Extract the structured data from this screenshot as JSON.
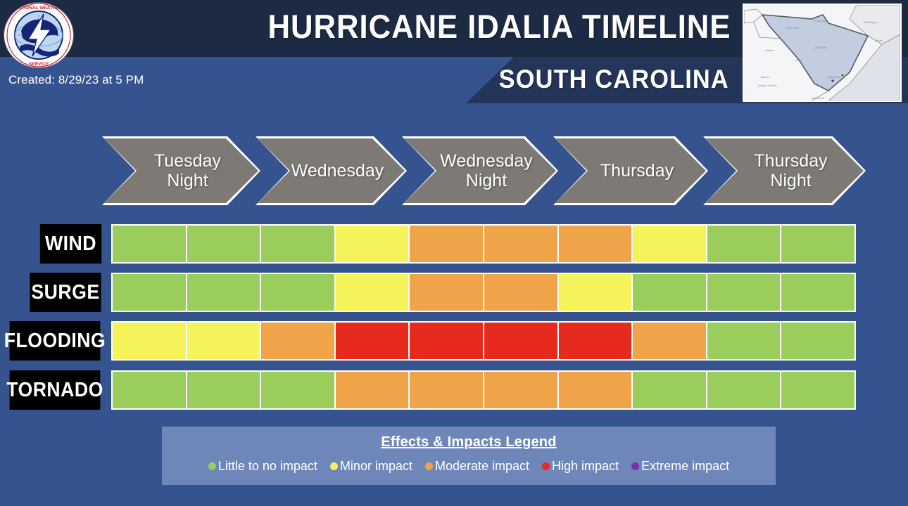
{
  "header": {
    "title": "Hurricane Idalia Timeline",
    "subtitle": "South Carolina",
    "created": "Created: 8/29/23 at 5 PM",
    "logo_alt": "National Weather Service",
    "map_alt": "South Carolina state map"
  },
  "colors": {
    "background": "#35538f",
    "header_band": "#1d2a44",
    "header_wedge": "#24355a",
    "chevron_fill": "#7d7975",
    "chevron_border": "#ffffff",
    "label_bg": "#000000",
    "legend_bg": "#6f86b8",
    "little": "#9acd5c",
    "minor": "#f4f45a",
    "moderate": "#f0a44a",
    "high": "#e62a1e",
    "extreme": "#7b2fa8"
  },
  "timeline": {
    "periods": [
      {
        "label": "Tuesday\nNight"
      },
      {
        "label": "Wednesday"
      },
      {
        "label": "Wednesday\nNight"
      },
      {
        "label": "Thursday"
      },
      {
        "label": "Thursday\nNight"
      }
    ]
  },
  "legend": {
    "title": "Effects & Impacts Legend",
    "items": [
      {
        "label": "Little to no impact",
        "color": "#9acd5c"
      },
      {
        "label": "Minor impact",
        "color": "#f4f45a"
      },
      {
        "label": "Moderate impact",
        "color": "#f0a44a"
      },
      {
        "label": "High impact",
        "color": "#e62a1e"
      },
      {
        "label": "Extreme impact",
        "color": "#7b2fa8"
      }
    ]
  },
  "chart_data": {
    "type": "heatmap",
    "title": "Hurricane Idalia Timeline - South Carolina",
    "xlabel": "",
    "ylabel": "",
    "x": [
      "Tuesday Night",
      "Wednesday",
      "Wednesday Night",
      "Thursday",
      "Thursday Night"
    ],
    "columns": 10,
    "levels": [
      "Little to no impact",
      "Minor impact",
      "Moderate impact",
      "High impact",
      "Extreme impact"
    ],
    "level_colors": [
      "#9acd5c",
      "#f4f45a",
      "#f0a44a",
      "#e62a1e",
      "#7b2fa8"
    ],
    "categories": [
      "WIND",
      "SURGE",
      "FLOODING",
      "TORNADO"
    ],
    "series": [
      {
        "name": "WIND",
        "label_offset": 53,
        "values": [
          "Little to no impact",
          "Little to no impact",
          "Little to no impact",
          "Minor impact",
          "Moderate impact",
          "Moderate impact",
          "Moderate impact",
          "Minor impact",
          "Little to no impact",
          "Little to no impact"
        ],
        "colors": [
          "#9acd5c",
          "#9acd5c",
          "#9acd5c",
          "#f4f45a",
          "#f0a44a",
          "#f0a44a",
          "#f0a44a",
          "#f4f45a",
          "#9acd5c",
          "#9acd5c"
        ]
      },
      {
        "name": "SURGE",
        "label_offset": 53,
        "values": [
          "Little to no impact",
          "Little to no impact",
          "Little to no impact",
          "Minor impact",
          "Moderate impact",
          "Moderate impact",
          "Minor impact",
          "Little to no impact",
          "Little to no impact",
          "Little to no impact"
        ],
        "colors": [
          "#9acd5c",
          "#9acd5c",
          "#9acd5c",
          "#f4f45a",
          "#f0a44a",
          "#f0a44a",
          "#f4f45a",
          "#9acd5c",
          "#9acd5c",
          "#9acd5c"
        ]
      },
      {
        "name": "FLOODING",
        "label_offset": 8,
        "values": [
          "Minor impact",
          "Minor impact",
          "Moderate impact",
          "High impact",
          "High impact",
          "High impact",
          "High impact",
          "Moderate impact",
          "Little to no impact",
          "Little to no impact"
        ],
        "colors": [
          "#f4f45a",
          "#f4f45a",
          "#f0a44a",
          "#e62a1e",
          "#e62a1e",
          "#e62a1e",
          "#e62a1e",
          "#f0a44a",
          "#9acd5c",
          "#9acd5c"
        ]
      },
      {
        "name": "TORNADO",
        "label_offset": 8,
        "values": [
          "Little to no impact",
          "Little to no impact",
          "Little to no impact",
          "Moderate impact",
          "Moderate impact",
          "Moderate impact",
          "Moderate impact",
          "Little to no impact",
          "Little to no impact",
          "Little to no impact"
        ],
        "colors": [
          "#9acd5c",
          "#9acd5c",
          "#9acd5c",
          "#f0a44a",
          "#f0a44a",
          "#f0a44a",
          "#f0a44a",
          "#9acd5c",
          "#9acd5c",
          "#9acd5c"
        ]
      }
    ]
  }
}
